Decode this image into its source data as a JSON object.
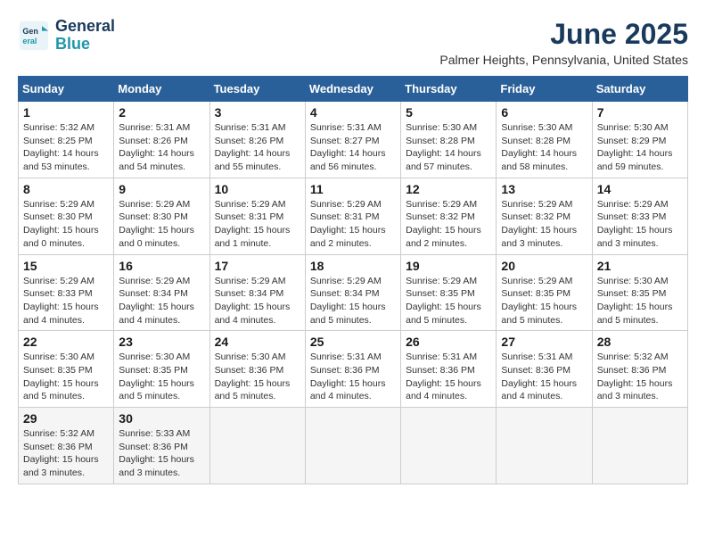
{
  "header": {
    "logo_line1": "General",
    "logo_line2": "Blue",
    "month": "June 2025",
    "location": "Palmer Heights, Pennsylvania, United States"
  },
  "days_of_week": [
    "Sunday",
    "Monday",
    "Tuesday",
    "Wednesday",
    "Thursday",
    "Friday",
    "Saturday"
  ],
  "weeks": [
    [
      {
        "day": "1",
        "info": "Sunrise: 5:32 AM\nSunset: 8:25 PM\nDaylight: 14 hours\nand 53 minutes."
      },
      {
        "day": "2",
        "info": "Sunrise: 5:31 AM\nSunset: 8:26 PM\nDaylight: 14 hours\nand 54 minutes."
      },
      {
        "day": "3",
        "info": "Sunrise: 5:31 AM\nSunset: 8:26 PM\nDaylight: 14 hours\nand 55 minutes."
      },
      {
        "day": "4",
        "info": "Sunrise: 5:31 AM\nSunset: 8:27 PM\nDaylight: 14 hours\nand 56 minutes."
      },
      {
        "day": "5",
        "info": "Sunrise: 5:30 AM\nSunset: 8:28 PM\nDaylight: 14 hours\nand 57 minutes."
      },
      {
        "day": "6",
        "info": "Sunrise: 5:30 AM\nSunset: 8:28 PM\nDaylight: 14 hours\nand 58 minutes."
      },
      {
        "day": "7",
        "info": "Sunrise: 5:30 AM\nSunset: 8:29 PM\nDaylight: 14 hours\nand 59 minutes."
      }
    ],
    [
      {
        "day": "8",
        "info": "Sunrise: 5:29 AM\nSunset: 8:30 PM\nDaylight: 15 hours\nand 0 minutes."
      },
      {
        "day": "9",
        "info": "Sunrise: 5:29 AM\nSunset: 8:30 PM\nDaylight: 15 hours\nand 0 minutes."
      },
      {
        "day": "10",
        "info": "Sunrise: 5:29 AM\nSunset: 8:31 PM\nDaylight: 15 hours\nand 1 minute."
      },
      {
        "day": "11",
        "info": "Sunrise: 5:29 AM\nSunset: 8:31 PM\nDaylight: 15 hours\nand 2 minutes."
      },
      {
        "day": "12",
        "info": "Sunrise: 5:29 AM\nSunset: 8:32 PM\nDaylight: 15 hours\nand 2 minutes."
      },
      {
        "day": "13",
        "info": "Sunrise: 5:29 AM\nSunset: 8:32 PM\nDaylight: 15 hours\nand 3 minutes."
      },
      {
        "day": "14",
        "info": "Sunrise: 5:29 AM\nSunset: 8:33 PM\nDaylight: 15 hours\nand 3 minutes."
      }
    ],
    [
      {
        "day": "15",
        "info": "Sunrise: 5:29 AM\nSunset: 8:33 PM\nDaylight: 15 hours\nand 4 minutes."
      },
      {
        "day": "16",
        "info": "Sunrise: 5:29 AM\nSunset: 8:34 PM\nDaylight: 15 hours\nand 4 minutes."
      },
      {
        "day": "17",
        "info": "Sunrise: 5:29 AM\nSunset: 8:34 PM\nDaylight: 15 hours\nand 4 minutes."
      },
      {
        "day": "18",
        "info": "Sunrise: 5:29 AM\nSunset: 8:34 PM\nDaylight: 15 hours\nand 5 minutes."
      },
      {
        "day": "19",
        "info": "Sunrise: 5:29 AM\nSunset: 8:35 PM\nDaylight: 15 hours\nand 5 minutes."
      },
      {
        "day": "20",
        "info": "Sunrise: 5:29 AM\nSunset: 8:35 PM\nDaylight: 15 hours\nand 5 minutes."
      },
      {
        "day": "21",
        "info": "Sunrise: 5:30 AM\nSunset: 8:35 PM\nDaylight: 15 hours\nand 5 minutes."
      }
    ],
    [
      {
        "day": "22",
        "info": "Sunrise: 5:30 AM\nSunset: 8:35 PM\nDaylight: 15 hours\nand 5 minutes."
      },
      {
        "day": "23",
        "info": "Sunrise: 5:30 AM\nSunset: 8:35 PM\nDaylight: 15 hours\nand 5 minutes."
      },
      {
        "day": "24",
        "info": "Sunrise: 5:30 AM\nSunset: 8:36 PM\nDaylight: 15 hours\nand 5 minutes."
      },
      {
        "day": "25",
        "info": "Sunrise: 5:31 AM\nSunset: 8:36 PM\nDaylight: 15 hours\nand 4 minutes."
      },
      {
        "day": "26",
        "info": "Sunrise: 5:31 AM\nSunset: 8:36 PM\nDaylight: 15 hours\nand 4 minutes."
      },
      {
        "day": "27",
        "info": "Sunrise: 5:31 AM\nSunset: 8:36 PM\nDaylight: 15 hours\nand 4 minutes."
      },
      {
        "day": "28",
        "info": "Sunrise: 5:32 AM\nSunset: 8:36 PM\nDaylight: 15 hours\nand 3 minutes."
      }
    ],
    [
      {
        "day": "29",
        "info": "Sunrise: 5:32 AM\nSunset: 8:36 PM\nDaylight: 15 hours\nand 3 minutes."
      },
      {
        "day": "30",
        "info": "Sunrise: 5:33 AM\nSunset: 8:36 PM\nDaylight: 15 hours\nand 3 minutes."
      },
      {
        "day": "",
        "info": ""
      },
      {
        "day": "",
        "info": ""
      },
      {
        "day": "",
        "info": ""
      },
      {
        "day": "",
        "info": ""
      },
      {
        "day": "",
        "info": ""
      }
    ]
  ]
}
